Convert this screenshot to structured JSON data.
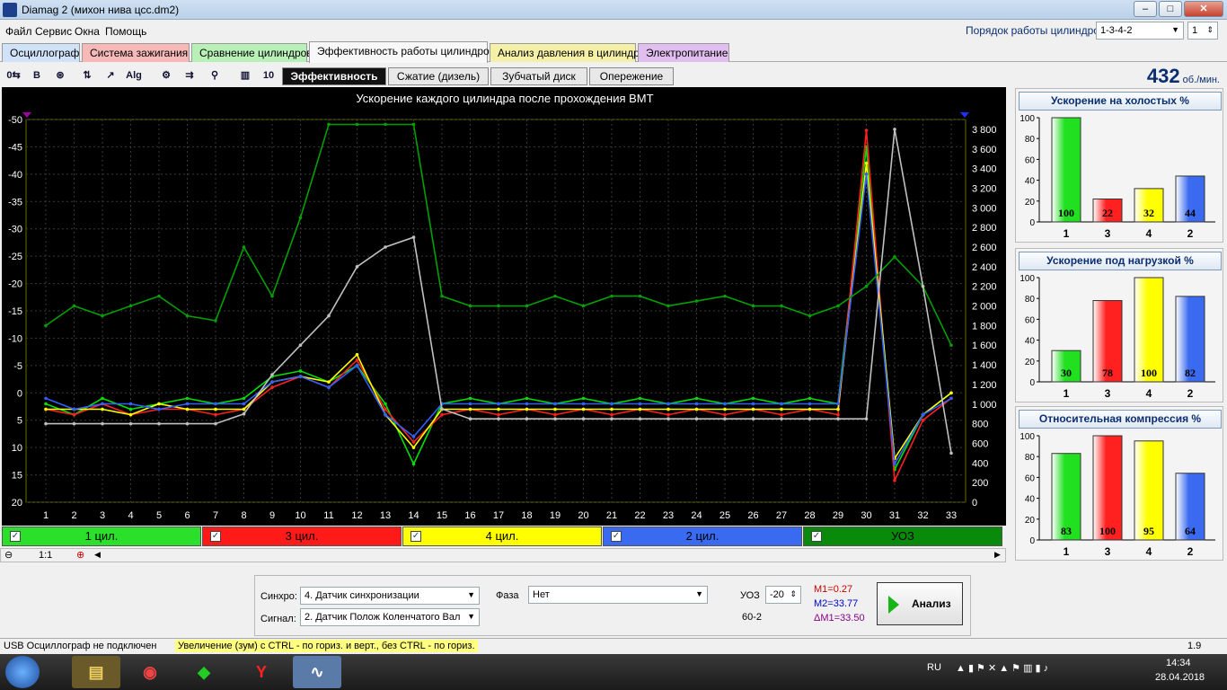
{
  "window": {
    "title": "Diamag 2 (михон нива цсс.dm2)",
    "min": "–",
    "max": "□",
    "close": "✕"
  },
  "menu": [
    "Файл",
    "Сервис",
    "Окна",
    "Помощь"
  ],
  "firing_order": {
    "label": "Порядок работы цилиндров",
    "value": "1-3-4-2",
    "count": "1"
  },
  "tabs": [
    {
      "label": "Осциллограф",
      "color": "#cfe2f8"
    },
    {
      "label": "Система зажигания",
      "color": "#f7b8b8"
    },
    {
      "label": "Сравнение цилиндров",
      "color": "#b8f0b8"
    },
    {
      "label": "Эффективность работы цилиндров",
      "color": "#f8f8f8"
    },
    {
      "label": "Анализ давления в цилиндре",
      "color": "#f5f0a8"
    },
    {
      "label": "Электропитание",
      "color": "#e0bff0"
    }
  ],
  "toolbar": {
    "icons": [
      "zero-offset-icon",
      "bold-icon",
      "rpm-icon",
      "scale-icon",
      "line-icon",
      "algorithm-icon",
      "filter-icon",
      "sort-icon",
      "marker-icon",
      "bars-icon",
      "ten-icon"
    ],
    "icon_glyphs": [
      "0⇆",
      "B",
      "⊛",
      "⇅",
      "↗",
      "Alg",
      "⚙",
      "⇉",
      "⚲",
      "▥",
      "10"
    ],
    "subtabs": [
      "Эффективность",
      "Сжатие (дизель)",
      "Зубчатый диск",
      "Опережение"
    ]
  },
  "rpm": {
    "value": "432",
    "unit": "об./мин."
  },
  "chart_data": {
    "type": "line",
    "title": "Ускорение каждого цилиндра после прохождения ВМТ",
    "left_ticks": [
      "-50",
      "-45",
      "-40",
      "-35",
      "-30",
      "-25",
      "-20",
      "-15",
      "-10",
      "-5",
      "0",
      "5",
      "10",
      "15",
      "20"
    ],
    "right_ticks": [
      "3 800",
      "3 600",
      "3 400",
      "3 200",
      "3 000",
      "2 800",
      "2 600",
      "2 400",
      "2 200",
      "2 000",
      "1 800",
      "1 600",
      "1 400",
      "1 200",
      "1 000",
      "800",
      "600",
      "400",
      "200",
      "0"
    ],
    "x_ticks": [
      "1",
      "2",
      "3",
      "4",
      "5",
      "6",
      "7",
      "8",
      "9",
      "10",
      "11",
      "12",
      "13",
      "14",
      "15",
      "16",
      "17",
      "18",
      "19",
      "20",
      "21",
      "22",
      "23",
      "24",
      "25",
      "26",
      "27",
      "28",
      "29",
      "30",
      "31",
      "32",
      "33"
    ],
    "left_range": [
      -50,
      20
    ],
    "right_range": [
      0,
      3900
    ],
    "grid": true,
    "series": [
      {
        "name": "1 цил.",
        "color": "#00e000",
        "values": [
          2,
          4,
          1,
          3,
          2,
          1,
          2,
          1,
          -3,
          -4,
          -2,
          -5,
          2,
          13,
          2,
          1,
          2,
          1,
          2,
          1,
          2,
          1,
          2,
          1,
          2,
          1,
          2,
          1,
          2,
          -45,
          14,
          4,
          0
        ]
      },
      {
        "name": "3 цил.",
        "color": "#ff2020",
        "values": [
          3,
          4,
          2,
          4,
          3,
          3,
          4,
          3,
          -1,
          -3,
          -1,
          -6,
          3,
          9,
          4,
          3,
          4,
          3,
          4,
          3,
          4,
          3,
          4,
          3,
          4,
          3,
          4,
          3,
          4,
          -48,
          16,
          5,
          1
        ]
      },
      {
        "name": "4 цил.",
        "color": "#ffff00",
        "values": [
          3,
          3,
          3,
          4,
          2,
          3,
          3,
          3,
          -2,
          -3,
          -2,
          -7,
          4,
          10,
          3,
          3,
          3,
          3,
          3,
          3,
          3,
          3,
          3,
          3,
          3,
          3,
          3,
          3,
          3,
          -42,
          12,
          4,
          0
        ]
      },
      {
        "name": "2 цил.",
        "color": "#3060ff",
        "values": [
          1,
          3,
          2,
          2,
          3,
          2,
          2,
          2,
          -2,
          -3,
          -1,
          -5,
          4,
          8,
          2,
          2,
          2,
          2,
          2,
          2,
          2,
          2,
          2,
          2,
          2,
          2,
          2,
          2,
          2,
          -40,
          13,
          4,
          1
        ]
      },
      {
        "name": "УОЗ",
        "color": "#00a000",
        "axis": "right",
        "values": [
          1800,
          2000,
          1900,
          2000,
          2100,
          1900,
          1850,
          2600,
          2100,
          2900,
          3850,
          3850,
          3850,
          3850,
          2100,
          2000,
          2000,
          2000,
          2100,
          2000,
          2100,
          2100,
          2000,
          2050,
          2100,
          2000,
          2000,
          1900,
          2000,
          2200,
          2500,
          2200,
          1600
        ]
      },
      {
        "name": "обороты",
        "color": "#c0c0c0",
        "axis": "right",
        "values": [
          800,
          800,
          800,
          800,
          800,
          800,
          800,
          900,
          1300,
          1600,
          1900,
          2400,
          2600,
          2700,
          950,
          850,
          850,
          850,
          850,
          850,
          850,
          850,
          850,
          850,
          850,
          850,
          850,
          850,
          850,
          850,
          3800,
          2200,
          500
        ]
      }
    ]
  },
  "legend": [
    {
      "label": "1 цил.",
      "color": "#2ae02a"
    },
    {
      "label": "3 цил.",
      "color": "#ff1a1a"
    },
    {
      "label": "4 цил.",
      "color": "#ffff00"
    },
    {
      "label": "2 цил.",
      "color": "#3a6af0"
    },
    {
      "label": "УОЗ",
      "color": "#0a8a0a"
    }
  ],
  "zoom": {
    "value": "1:1"
  },
  "controls": {
    "sync_label": "Синхро:",
    "sync_value": "4.  Датчик синхронизации",
    "signal_label": "Сигнал:",
    "signal_value": "2.  Датчик Полож Коленчатого Вал",
    "phase_label": "Фаза",
    "phase_value": "Нет",
    "uoz_label": "УОЗ",
    "uoz_value": "-20",
    "teeth": "60-2",
    "m1": "M1=0.27",
    "m2": "M2=33.77",
    "dm": "ΔM1=33.50",
    "analyze_label": "Анализ"
  },
  "panels": [
    {
      "title": "Ускорение на холостых %",
      "categories": [
        "1",
        "3",
        "4",
        "2"
      ],
      "values": [
        100,
        22,
        32,
        44
      ]
    },
    {
      "title": "Ускорение под нагрузкой %",
      "categories": [
        "1",
        "3",
        "4",
        "2"
      ],
      "values": [
        30,
        78,
        100,
        82
      ]
    },
    {
      "title": "Относительная компрессия %",
      "categories": [
        "1",
        "3",
        "4",
        "2"
      ],
      "values": [
        83,
        100,
        95,
        64
      ]
    }
  ],
  "panel_ticks": [
    "0",
    "20",
    "40",
    "60",
    "80",
    "100"
  ],
  "bar_colors": [
    "#20e020",
    "#ff2020",
    "#ffff00",
    "#3a6af0"
  ],
  "status": {
    "usb": "USB Осциллограф не подключен",
    "hint": "Увеличение (зум) с CTRL - по гориз. и верт., без CTRL - по гориз.",
    "version": "1.9"
  },
  "taskbar": {
    "lang": "RU",
    "time": "14:34",
    "date": "28.04.2018"
  }
}
